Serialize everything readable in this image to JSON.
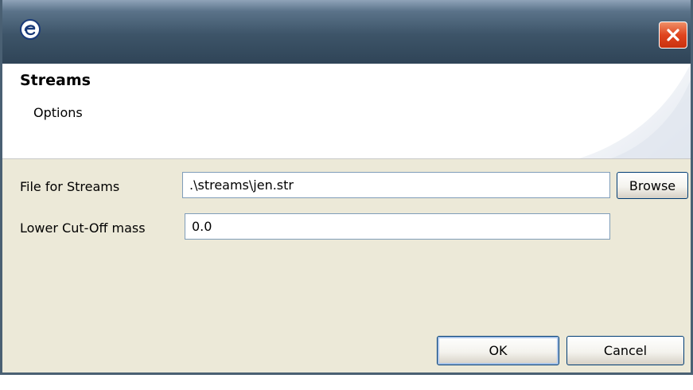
{
  "window": {
    "app_icon": "eclipse-e-icon",
    "close_icon": "close-icon"
  },
  "header": {
    "title": "Streams",
    "subtitle": "Options"
  },
  "form": {
    "file_label": "File for Streams",
    "file_value": ".\\streams\\jen.str",
    "browse_label": "Browse",
    "mass_label": "Lower Cut-Off mass",
    "mass_value": "0.0"
  },
  "buttons": {
    "ok_label": "OK",
    "cancel_label": "Cancel"
  },
  "colors": {
    "titlebar": "#3d5468",
    "close": "#e0451f",
    "dialog_bg": "#ece9d8"
  }
}
